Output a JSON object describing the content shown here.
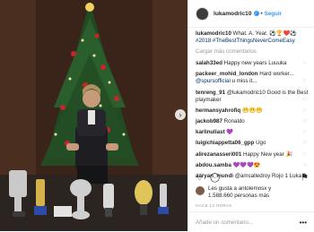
{
  "post": {
    "username": "lukamodric10",
    "follow_label": "Seguir",
    "caption_user": "lukamodric10",
    "caption_text": "What. A. Year. ⚽🏆❤️⚽",
    "caption_tags": "#2018 #TheBestThingsNeverComeEasy",
    "load_more": "Cargar más comentarios",
    "comments": [
      {
        "user": "salah33ed",
        "text": "Happy new years Luuuka"
      },
      {
        "user": "packeer_mohid_london",
        "text": "Hard worker...",
        "mention": "@spursofficial",
        "text2": "u miss it..."
      },
      {
        "user": "tenreng_91",
        "text": "@lukamodric10 Good is the Best playmaker"
      },
      {
        "user": "hermansyahrofiq",
        "text": "😬😬😬"
      },
      {
        "user": "jackob987",
        "text": "Ronaldo"
      },
      {
        "user": "karlinuliast",
        "text": "💜"
      },
      {
        "user": "luigichiappetta06_gpp",
        "text": "Ugo"
      },
      {
        "user": "alirezanasseri001",
        "text": "Happy New year 🎉"
      },
      {
        "user": "abdou.samba",
        "text": "💜💜💜😍"
      },
      {
        "user": "aaryan_mundi",
        "text": "@amcalledroy Rojo 1 Luka 0"
      }
    ],
    "likes_line1": "Les gusta a antolemosx y",
    "likes_line2": "1.588.660 personas más",
    "age": "HACE 13 HORAS",
    "add_comment_placeholder": "Añade un comentario...",
    "options_icon": "ellipsis-icon"
  }
}
